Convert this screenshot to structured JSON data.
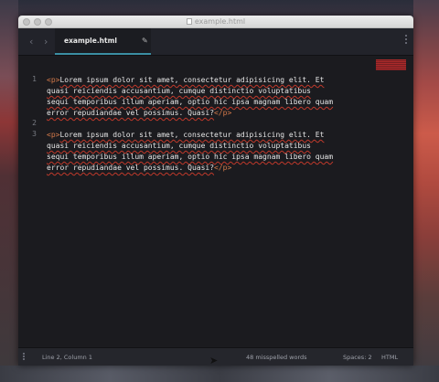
{
  "window": {
    "title": "example.html"
  },
  "tabbar": {
    "back_icon": "‹",
    "forward_icon": "›",
    "active_tab": "example.html",
    "edit_icon": "✎"
  },
  "editor": {
    "line_numbers": [
      "1",
      "",
      "",
      "",
      "2",
      "3",
      "",
      "",
      ""
    ],
    "lines": [
      {
        "open": "<p>",
        "text": "Lorem ipsum dolor sit amet, consectetur adipisicing elit. Et",
        "close": ""
      },
      {
        "open": "",
        "text": "quasi reiciendis accusantium, cumque distinctio voluptatibus",
        "close": ""
      },
      {
        "open": "",
        "text": "sequi temporibus illum aperiam, optio hic ipsa magnam libero quam",
        "close": ""
      },
      {
        "open": "",
        "text": "error repudiandae vel possimus. Quasi?",
        "close": "</p>"
      },
      {
        "open": "",
        "text": "",
        "close": ""
      },
      {
        "open": "<p>",
        "text": "Lorem ipsum dolor sit amet, consectetur adipisicing elit. Et",
        "close": ""
      },
      {
        "open": "",
        "text": "quasi reiciendis accusantium, cumque distinctio voluptatibus",
        "close": ""
      },
      {
        "open": "",
        "text": "sequi temporibus illum aperiam, optio hic ipsa magnam libero quam",
        "close": ""
      },
      {
        "open": "",
        "text": "error repudiandae vel possimus. Quasi?",
        "close": "</p>"
      }
    ]
  },
  "statusbar": {
    "position": "Line 2, Column 1",
    "spelling": "48 misspelled words",
    "spaces": "Spaces: 2",
    "syntax": "HTML"
  },
  "colors": {
    "accent": "#3b8ea3",
    "tag": "#d57a4a",
    "spell_error": "#c0392b"
  }
}
